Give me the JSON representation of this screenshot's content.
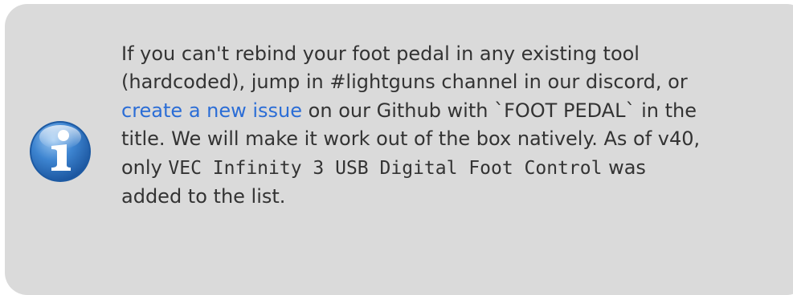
{
  "note": {
    "icon": "info-icon",
    "line1": "If you can't rebind your foot pedal in any existing tool",
    "line2": "(hardcoded), jump in #lightguns channel in our discord, or",
    "link_text": "create a new issue",
    "line3_after_link": " on our Github with `FOOT PEDAL` in the",
    "line4": "title. We will make it work out of the box natively. As of v40,",
    "line5_before_code": "only ",
    "device_name": "VEC Infinity 3 USB Digital Foot Control",
    "line5_after_code": " was",
    "line6": "added to the list.",
    "colors": {
      "box_background": "#dadada",
      "text": "#333333",
      "link": "#2b6dd6",
      "icon_blue": "#2f74c4"
    }
  }
}
